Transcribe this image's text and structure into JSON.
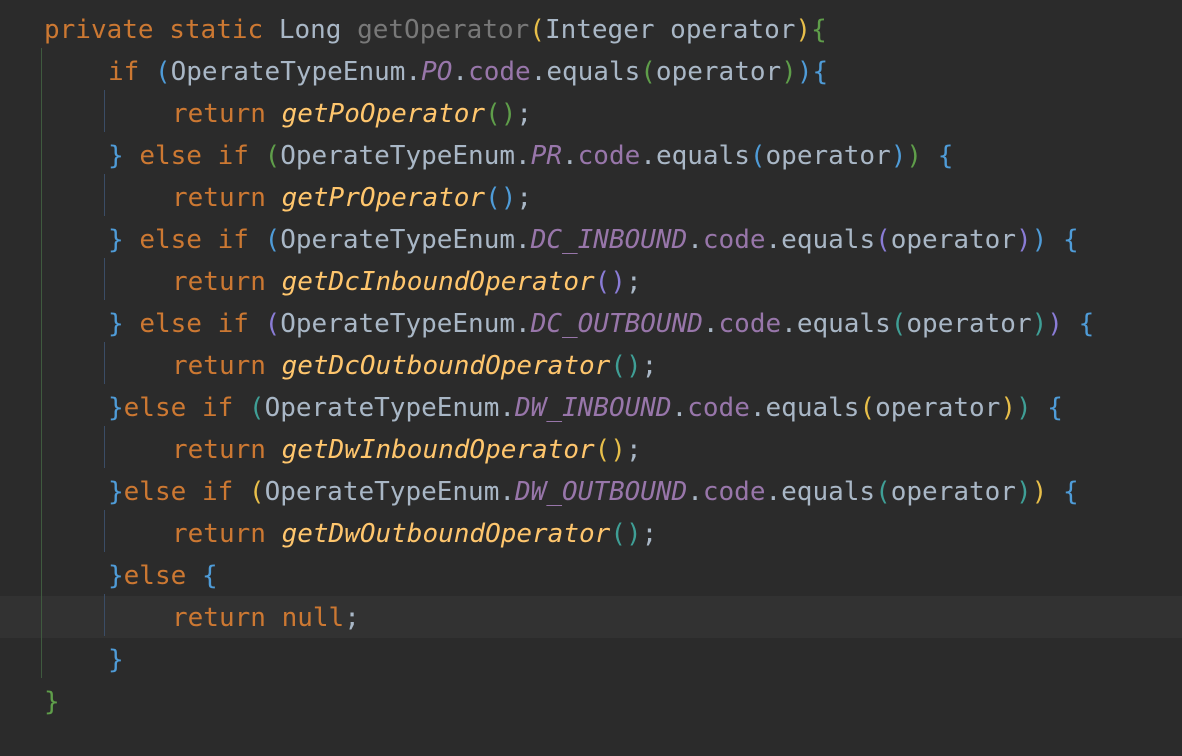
{
  "code": {
    "kw_private": "private",
    "kw_static": "static",
    "kw_if": "if",
    "kw_else": "else",
    "kw_return": "return",
    "kw_null": "null",
    "type_long": "Long",
    "type_integer": "Integer",
    "method_name": "getOperator",
    "param_name": "operator",
    "enum_class": "OperateTypeEnum",
    "field_code": "code",
    "method_equals": "equals",
    "constants": [
      "PO",
      "PR",
      "DC_INBOUND",
      "DC_OUTBOUND",
      "DW_INBOUND",
      "DW_OUTBOUND"
    ],
    "return_calls": [
      "getPoOperator",
      "getPrOperator",
      "getDcInboundOperator",
      "getDcOutboundOperator",
      "getDwInboundOperator",
      "getDwOutboundOperator"
    ]
  },
  "colors": {
    "background": "#2b2b2b",
    "keyword": "#cc7832",
    "text": "#a9b7c6",
    "enum_constant": "#9876aa",
    "method_call": "#ffc66d",
    "current_line": "#323232"
  }
}
